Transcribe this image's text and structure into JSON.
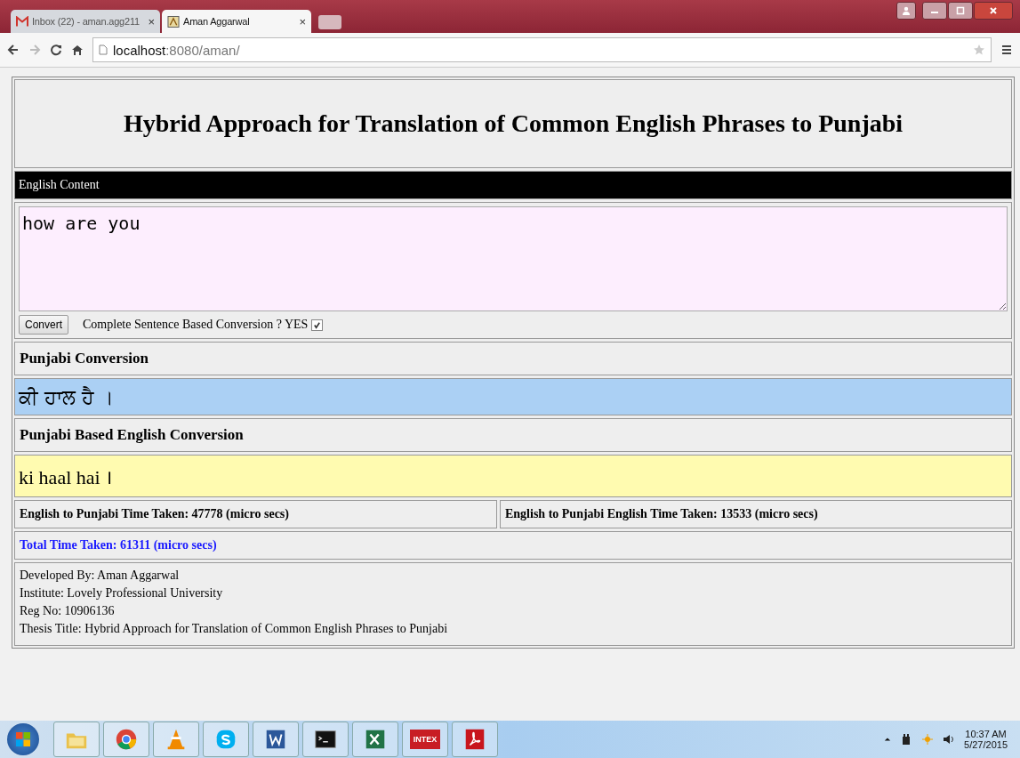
{
  "browser": {
    "tabs": [
      {
        "label": "Inbox (22) - aman.agg211",
        "close": "×",
        "selected": false
      },
      {
        "label": "Aman Aggarwal",
        "close": "×",
        "selected": true
      }
    ],
    "url": {
      "host": "localhost",
      "path": ":8080/aman/"
    }
  },
  "page": {
    "title": "Hybrid Approach for Translation of Common English Phrases to Punjabi",
    "input_bar": "English Content",
    "input": {
      "value": "how are you"
    },
    "convert_button": "Convert",
    "option": {
      "label": "Complete Sentence Based Conversion ? YES",
      "checked": true
    },
    "punjabi_heading": "Punjabi Conversion",
    "punjabi_output": "ਕੀ ਹਾਲ ਹੈ ।",
    "roman_heading": "Punjabi Based English Conversion",
    "roman_output": "ki haal hai ।",
    "times": [
      "English to Punjabi Time Taken: 47778 (micro secs)",
      "English to Punjabi English Time Taken: 13533 (micro secs)"
    ],
    "total": "Total Time Taken: 61311 (micro secs)",
    "credits": [
      "Developed By: Aman Aggarwal",
      "Institute: Lovely Professional University",
      "Reg No: 10906136",
      "Thesis Title: Hybrid Approach for Translation of Common English Phrases to Punjabi"
    ]
  },
  "taskbar": {
    "apps": [
      {
        "kind": "folder"
      },
      {
        "kind": "browser"
      },
      {
        "kind": "cone"
      },
      {
        "kind": "chat"
      },
      {
        "kind": "word"
      },
      {
        "kind": "terminal"
      },
      {
        "kind": "sheet"
      },
      {
        "kind": "brand",
        "label": "INTEX"
      },
      {
        "kind": "pdf"
      }
    ],
    "time": "10:37 AM",
    "date": "5/27/2015"
  }
}
